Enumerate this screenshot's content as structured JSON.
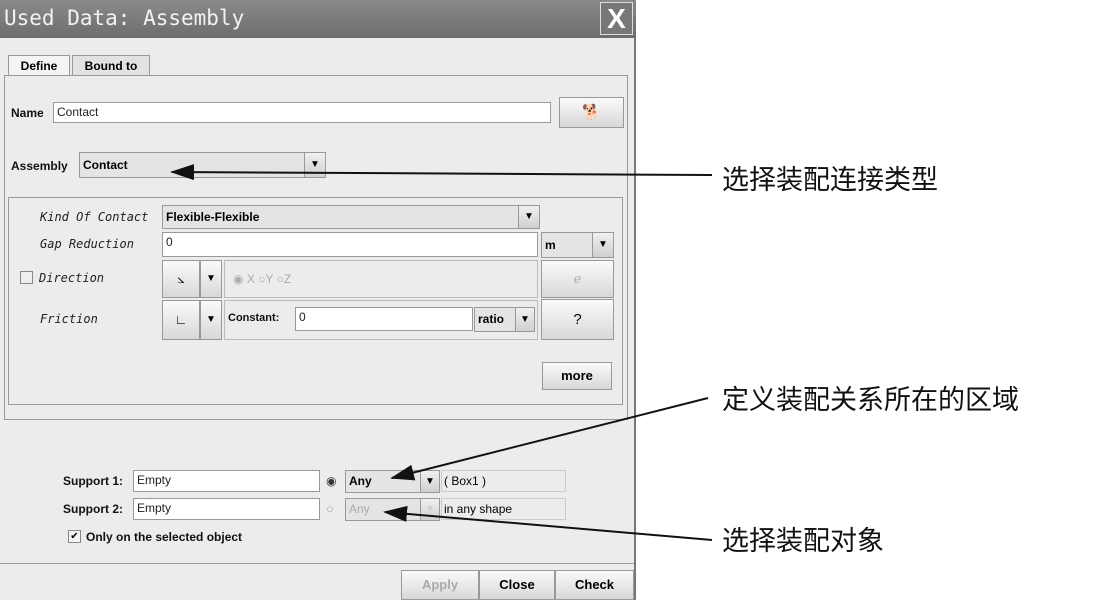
{
  "window": {
    "title": "Used Data: Assembly",
    "close_label": "X"
  },
  "tabs": [
    {
      "label": "Define",
      "active": true
    },
    {
      "label": "Bound to",
      "active": false
    }
  ],
  "name": {
    "label": "Name",
    "value": "Contact",
    "button_icon": "running-dog-icon"
  },
  "assembly": {
    "label": "Assembly",
    "value": "Contact"
  },
  "contact": {
    "kind_label": "Kind Of Contact",
    "kind_value": "Flexible-Flexible",
    "gap_label": "Gap Reduction",
    "gap_value": "0",
    "gap_unit": "m",
    "direction_label": "Direction",
    "direction_checked": false,
    "direction_options": [
      "X",
      "Y",
      "Z"
    ],
    "direction_selected": "X",
    "friction_label": "Friction",
    "friction_constant_label": "Constant:",
    "friction_value": "0",
    "friction_unit": "ratio",
    "help_label": "?",
    "more_label": "more"
  },
  "supports": [
    {
      "label": "Support 1:",
      "value": "Empty",
      "selected": true,
      "combo": "Any",
      "info": "( Box1 )"
    },
    {
      "label": "Support 2:",
      "value": "Empty",
      "selected": false,
      "combo": "Any",
      "info": "in any shape"
    }
  ],
  "only_selected": {
    "label": "Only on the selected object",
    "checked": true
  },
  "footer": {
    "apply": "Apply",
    "close": "Close",
    "check": "Check"
  },
  "annotations": [
    "选择装配连接类型",
    "定义装配关系所在的区域",
    "选择装配对象"
  ]
}
